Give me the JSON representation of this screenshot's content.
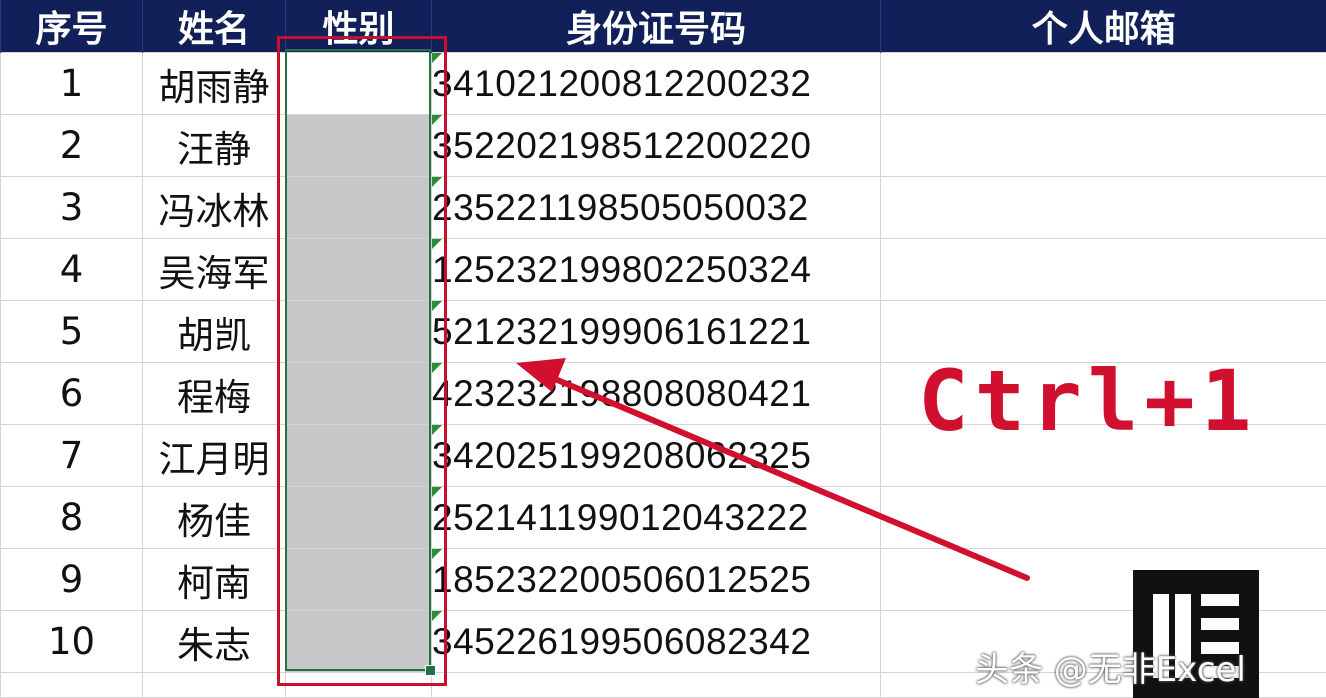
{
  "headers": {
    "num": "序号",
    "name": "姓名",
    "gender": "性别",
    "id": "身份证号码",
    "email": "个人邮箱"
  },
  "rows": [
    {
      "num": "1",
      "name": "胡雨静",
      "id": "341021200812200232"
    },
    {
      "num": "2",
      "name": "汪静",
      "id": "352202198512200220"
    },
    {
      "num": "3",
      "name": "冯冰林",
      "id": "235221198505050032"
    },
    {
      "num": "4",
      "name": "吴海军",
      "id": "125232199802250324"
    },
    {
      "num": "5",
      "name": "胡凯",
      "id": "521232199906161221"
    },
    {
      "num": "6",
      "name": "程梅",
      "id": "423232198808080421"
    },
    {
      "num": "7",
      "name": "江月明",
      "id": "342025199208062325"
    },
    {
      "num": "8",
      "name": "杨佳",
      "id": "252141199012043222"
    },
    {
      "num": "9",
      "name": "柯南",
      "id": "185232200506012525"
    },
    {
      "num": "10",
      "name": "朱志",
      "id": "345226199506082342"
    }
  ],
  "annotation": {
    "shortcut": "Ctrl+1",
    "color": "#d0102e"
  },
  "watermark": "头条 @无非Excel",
  "colors": {
    "header_bg": "#12205a",
    "selection": "#217346",
    "selected_fill": "#c8c8c8"
  }
}
